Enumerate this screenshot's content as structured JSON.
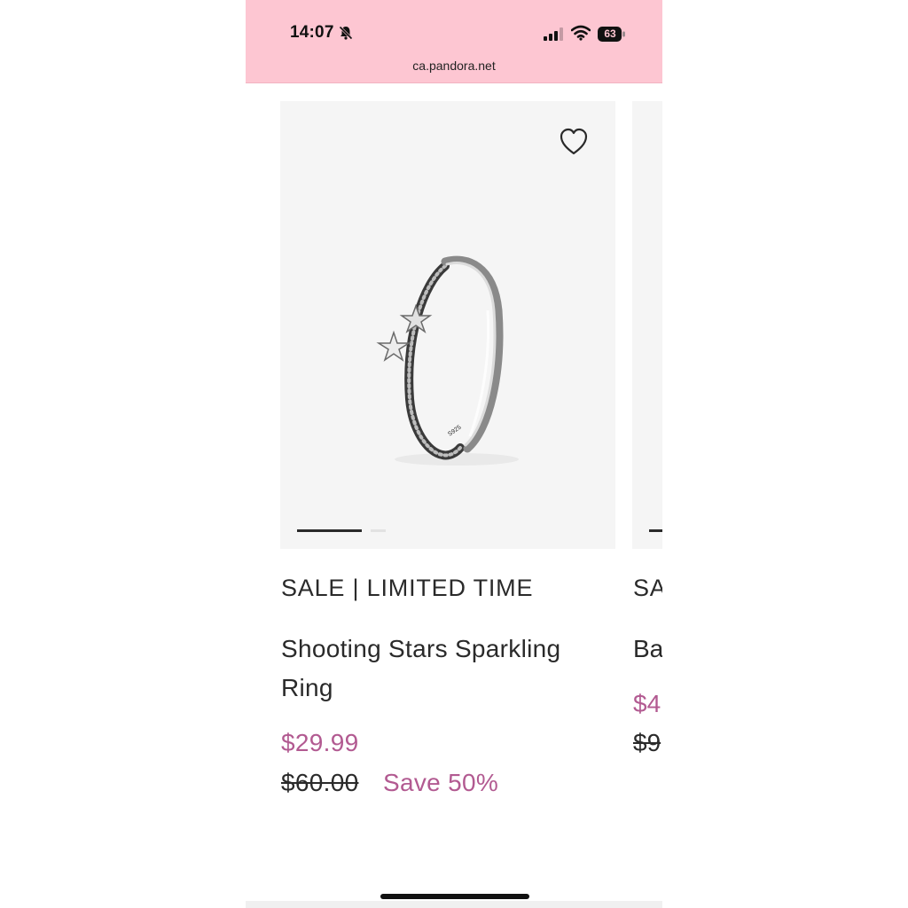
{
  "status_bar": {
    "time": "14:07",
    "battery": "63",
    "url": "ca.pandora.net",
    "colors": {
      "background": "#fdc6d2"
    },
    "icons": [
      "bell-slash-icon",
      "signal-icon",
      "wifi-icon",
      "battery-icon"
    ]
  },
  "products": [
    {
      "badge": "SALE | LIMITED TIME",
      "title": "Shooting Stars Sparkling Ring",
      "price": "$29.99",
      "old_price": "$60.00",
      "save": "Save 50%",
      "image_icon": "ring-image",
      "wishlist_icon": "heart-icon",
      "carousel": {
        "total": 2,
        "active": 1
      }
    },
    {
      "badge": "SA",
      "title": "Ba",
      "price": "$4",
      "old_price": "$9"
    }
  ],
  "colors": {
    "sale_price": "#b25a91",
    "text": "#2a2a2a",
    "card_bg": "#f5f5f5"
  }
}
